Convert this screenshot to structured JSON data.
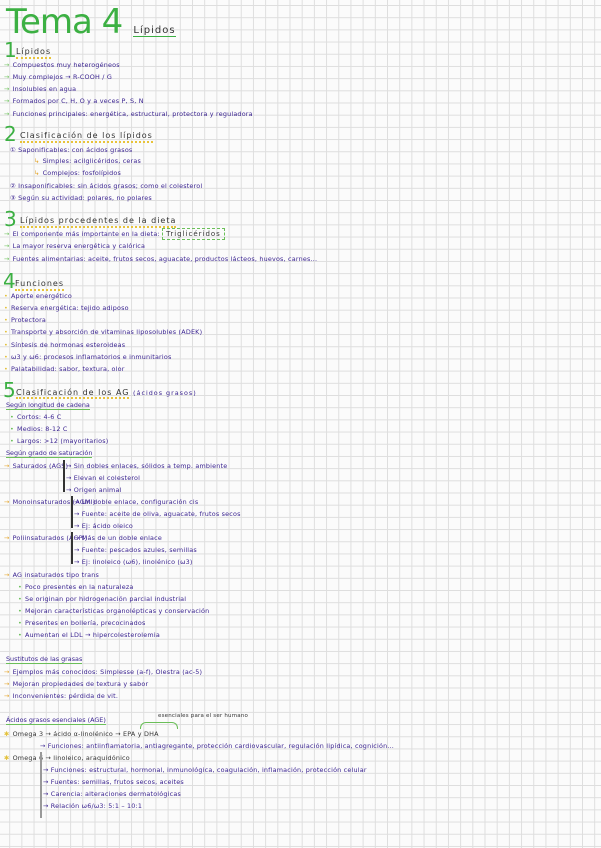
{
  "title": {
    "main": "Tema 4",
    "topic": "Lípidos"
  },
  "s1": {
    "num": "1",
    "heading": "Lípidos",
    "items": [
      "Compuestos muy heterogéneos",
      "Muy complejos → R-COOH / G",
      "Insolubles en agua",
      "Formados por C, H, O y a veces P, S, N",
      "Funciones principales: energética, estructural, protectora y reguladora"
    ]
  },
  "s2": {
    "num": "2",
    "heading": "Clasificación de los lípidos",
    "items": [
      "① Saponificables: con ácidos grasos",
      "Simples: acilglicéridos, ceras",
      "Complejos: fosfolípidos",
      "② Insaponificables: sin ácidos grasos; como el colesterol",
      "③ Según su actividad: polares, no polares"
    ]
  },
  "s3": {
    "num": "3",
    "heading": "Lípidos procedentes de la dieta",
    "items": [
      "El componente más importante en la dieta:",
      "Triglicéridos",
      "La mayor reserva energética y calórica",
      "Fuentes alimentarias: aceite, frutos secos, aguacate, productos lácteos, huevos, carnes..."
    ]
  },
  "s4": {
    "num": "4",
    "heading": "Funciones",
    "items": [
      "Aporte energético",
      "Reserva energética: tejido adiposo",
      "Protectora",
      "Transporte y absorción de vitaminas liposolubles (ADEK)",
      "Síntesis de hormonas esteroideas",
      "ω3 y ω6: procesos inflamatorios e inmunitarios",
      "Palatabilidad: sabor, textura, olor"
    ]
  },
  "s5": {
    "num": "5",
    "heading": "Clasificación de los AG",
    "heading_note": "(ácidos grasos)",
    "length_title": "Según longitud de cadena",
    "length": [
      "Cortos: 4-6 C",
      "Medios: 8-12 C",
      "Largos: >12 (mayoritarios)"
    ],
    "sat_title": "Según grado de saturación",
    "sat": [
      {
        "label": "Saturados (AGS)",
        "items": [
          "Sin dobles enlaces, sólidos a temp. ambiente",
          "Elevan el colesterol",
          "Origen animal"
        ]
      },
      {
        "label": "Monoinsaturados (AGMI)",
        "items": [
          "Un doble enlace, configuración cis",
          "Fuente: aceite de oliva, aguacate, frutos secos",
          "Ej: ácido oleico"
        ]
      },
      {
        "label": "Poliinsaturados (AGPI)",
        "items": [
          "Más de un doble enlace",
          "Fuente: pescados azules, semillas",
          "Ej: linoleico (ω6), linolénico (ω3)"
        ]
      }
    ],
    "trans_label": "AG insaturados tipo trans",
    "trans": [
      "Poco presentes en la naturaleza",
      "Se originan por hidrogenación parcial industrial",
      "Mejoran características organolépticas y conservación",
      "Presentes en bollería, precocinados",
      "Aumentan el LDL → hipercolesterolemia"
    ]
  },
  "subs": {
    "title": "Sustitutos de las grasas",
    "items": [
      "Ejemplos más conocidos: Simplesse (a-f), Olestra (ac-5)",
      "Mejoran propiedades de textura y sabor",
      "Inconvenientes: pérdida de vit."
    ]
  },
  "age": {
    "title": "Ácidos grasos esenciales (AGE)",
    "note": "esenciales para el ser humano",
    "o3_label": "Omega 3 → ácido α-linolénico → EPA y DHA",
    "o3": [
      "Funciones: antiinflamatoria, antiagregante, protección cardiovascular, regulación lipídica, cognición..."
    ],
    "o6_label": "Omega 6 → linoleico, araquidónico",
    "o6": [
      "Funciones: estructural, hormonal, inmunológica, coagulación, inflamación, protección celular",
      "Fuentes: semillas, frutos secos, aceites",
      "Carencia: alteraciones dermatológicas",
      "Relación ω6/ω3: 5:1 – 10:1"
    ]
  }
}
